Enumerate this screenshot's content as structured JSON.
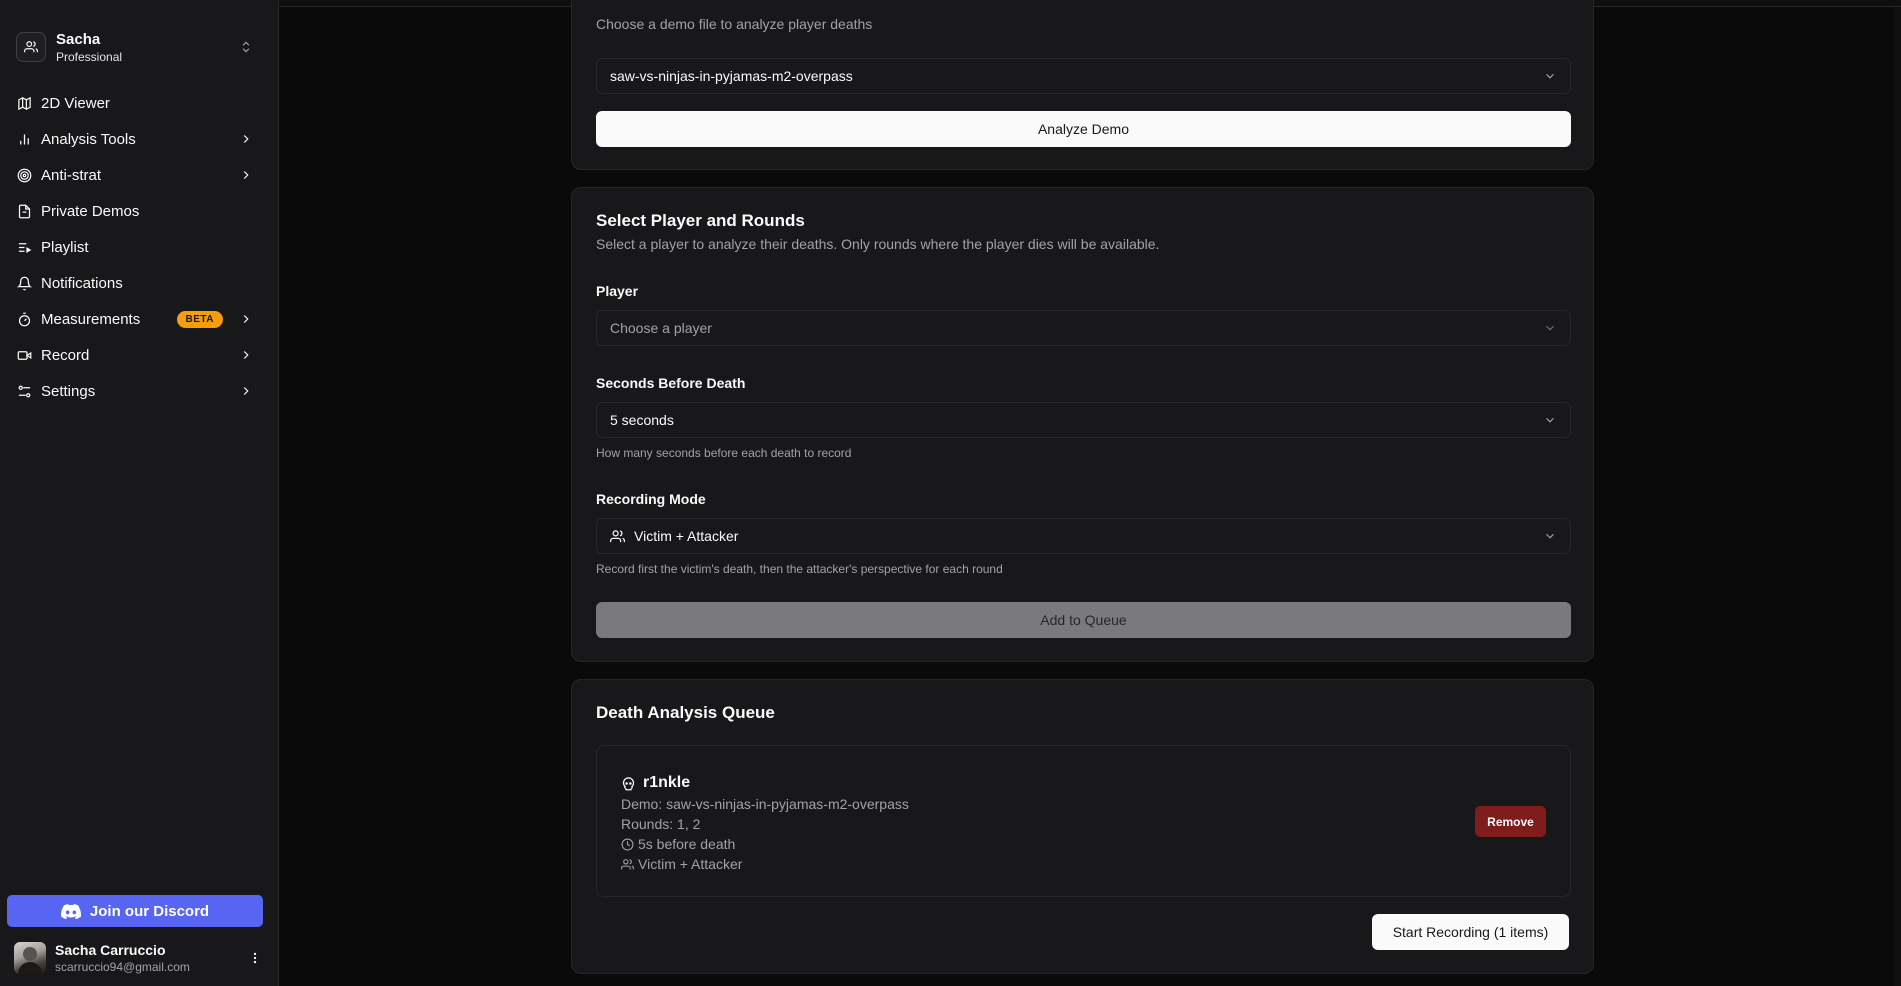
{
  "workspace": {
    "name": "Sacha",
    "plan": "Professional"
  },
  "nav": [
    {
      "label": "2D Viewer",
      "icon": "map-icon"
    },
    {
      "label": "Analysis Tools",
      "icon": "bar-chart-icon",
      "has_submenu": true
    },
    {
      "label": "Anti-strat",
      "icon": "target-icon",
      "has_submenu": true
    },
    {
      "label": "Private Demos",
      "icon": "file-icon"
    },
    {
      "label": "Playlist",
      "icon": "playlist-icon"
    },
    {
      "label": "Notifications",
      "icon": "bell-icon"
    },
    {
      "label": "Measurements",
      "icon": "timer-icon",
      "badge": "BETA",
      "has_submenu": true
    },
    {
      "label": "Record",
      "icon": "video-icon",
      "has_submenu": true
    },
    {
      "label": "Settings",
      "icon": "sliders-icon",
      "has_submenu": true
    }
  ],
  "discord": {
    "label": "Join our Discord",
    "color": "#5865f2"
  },
  "user": {
    "name": "Sacha Carruccio",
    "email": "scarruccio94@gmail.com"
  },
  "demo_card": {
    "description": "Choose a demo file to analyze player deaths",
    "selected_demo": "saw-vs-ninjas-in-pyjamas-m2-overpass",
    "analyze_label": "Analyze Demo"
  },
  "player_card": {
    "title": "Select Player and Rounds",
    "description": "Select a player to analyze their deaths. Only rounds where the player dies will be available.",
    "player_label": "Player",
    "player_placeholder": "Choose a player",
    "seconds_label": "Seconds Before Death",
    "seconds_value": "5 seconds",
    "seconds_help": "How many seconds before each death to record",
    "mode_label": "Recording Mode",
    "mode_value": "Victim + Attacker",
    "mode_help": "Record first the victim's death, then the attacker's perspective for each round",
    "add_label": "Add to Queue"
  },
  "queue": {
    "title": "Death Analysis Queue",
    "items": [
      {
        "player": "r1nkle",
        "demo": "Demo: saw-vs-ninjas-in-pyjamas-m2-overpass",
        "rounds": "Rounds: 1, 2",
        "seconds": "5s before death",
        "mode": "Victim + Attacker",
        "remove_label": "Remove"
      }
    ],
    "start_label": "Start Recording (1 items)"
  },
  "colors": {
    "beta_badge": "#f59e0b",
    "remove": "#7f1d1d",
    "accent_discord": "#5865f2"
  }
}
